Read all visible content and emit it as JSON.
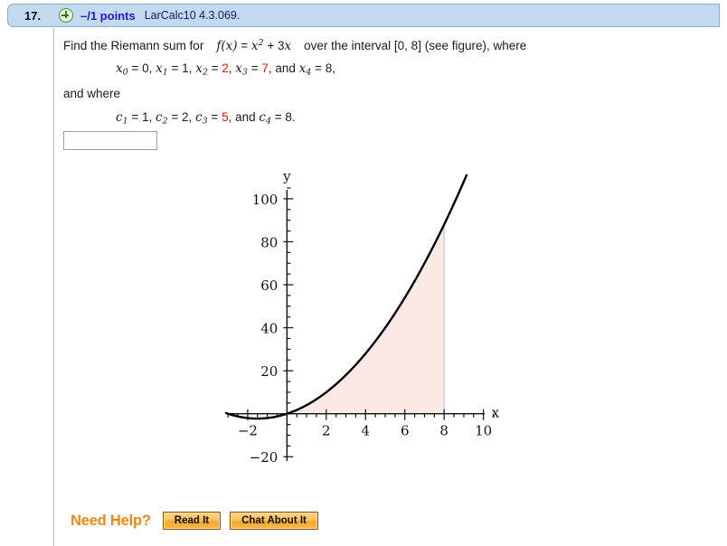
{
  "header": {
    "question_number": "17.",
    "plus_icon": "plus-circle-icon",
    "points": "–/1 points",
    "reference": "LarCalc10 4.3.069."
  },
  "problem": {
    "line1_a": "Find the Riemann sum for",
    "line1_f": "f",
    "line1_paren_x": "(x)",
    "line1_eq": "=",
    "line1_x": "x",
    "line1_exp": "2",
    "line1_plus": "+ 3",
    "line1_x2": "x",
    "line1_b": "over the interval [0, 8] (see figure), where",
    "x_values": {
      "x0_label": "x",
      "x0_sub": "0",
      "x0_val": "0",
      "x1_label": "x",
      "x1_sub": "1",
      "x1_val": "1",
      "x2_label": "x",
      "x2_sub": "2",
      "x2_val": "2",
      "x3_label": "x",
      "x3_sub": "3",
      "x3_val": "7",
      "x4_label": "x",
      "x4_sub": "4",
      "x4_val": "8",
      "and": "and",
      "trailing": ","
    },
    "line3": "and where",
    "c_values": {
      "c1_label": "c",
      "c1_sub": "1",
      "c1_val": "1",
      "c2_label": "c",
      "c2_sub": "2",
      "c2_val": "2",
      "c3_label": "c",
      "c3_sub": "3",
      "c3_val": "5",
      "c4_label": "c",
      "c4_sub": "4",
      "c4_val": "8",
      "and": "and",
      "trailing": "."
    },
    "red_color": "#e01b00"
  },
  "answer": {
    "value": "",
    "placeholder": ""
  },
  "chart_data": {
    "type": "line",
    "title": "",
    "xlabel": "x",
    "ylabel": "y",
    "function": "f(x) = x^2 + 3x",
    "xlim": [
      -3.1,
      10.8
    ],
    "ylim": [
      -22,
      105
    ],
    "x_ticks": [
      -2,
      2,
      4,
      6,
      8,
      10
    ],
    "x_tick_labels": [
      "−2",
      "2",
      "4",
      "6",
      "8",
      "10"
    ],
    "x_minor_step": 0.5,
    "y_ticks": [
      -20,
      20,
      40,
      60,
      80,
      100
    ],
    "y_tick_labels": [
      "−20",
      "20",
      "40",
      "60",
      "80",
      "100"
    ],
    "y_minor_step": 5,
    "grid": false,
    "legend": null,
    "curve_color": "#000000",
    "shaded_region": {
      "label": "area under curve",
      "x_from": 0,
      "x_to": 8,
      "fill_color": "#fce9e6",
      "edge_color": "#bdbdbd"
    },
    "series": [
      {
        "name": "f(x) = x^2 + 3x",
        "x": [
          -3.1,
          -3,
          -2.5,
          -2,
          -1.5,
          -1,
          -0.5,
          0,
          0.5,
          1,
          1.5,
          2,
          2.5,
          3,
          3.5,
          4,
          4.5,
          5,
          5.5,
          6,
          6.5,
          7,
          7.5,
          8,
          8.25
        ],
        "y": [
          0.31,
          0,
          -1.25,
          -2,
          -2.25,
          -2,
          -1.25,
          0,
          1.75,
          4,
          6.75,
          10,
          13.75,
          18,
          22.75,
          28,
          33.75,
          40,
          46.75,
          54,
          61.75,
          70,
          78.75,
          88,
          92.81
        ]
      }
    ]
  },
  "need_help": {
    "label": "Need Help?",
    "read_it": "Read It",
    "chat_about_it": "Chat About It"
  }
}
